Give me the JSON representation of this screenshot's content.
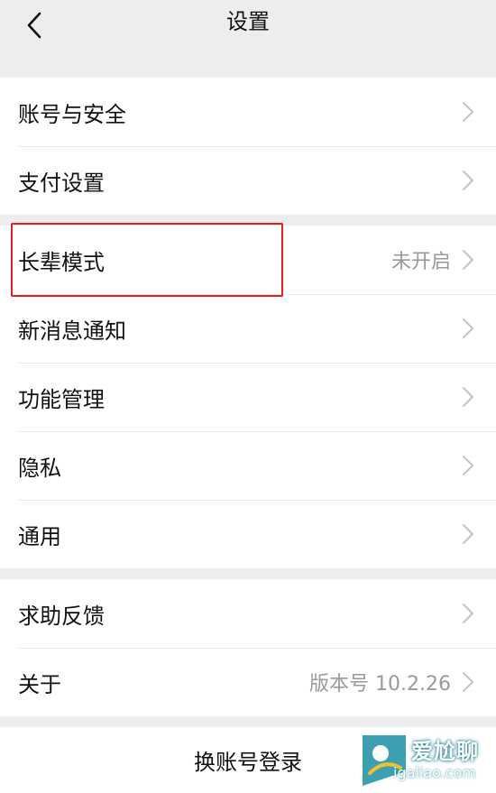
{
  "nav": {
    "title": "设置",
    "back_icon": "chevron-left-icon"
  },
  "groups": [
    {
      "items": [
        {
          "label": "账号与安全",
          "value": ""
        },
        {
          "label": "支付设置",
          "value": ""
        }
      ]
    },
    {
      "items": [
        {
          "label": "长辈模式",
          "value": "未开启"
        },
        {
          "label": "新消息通知",
          "value": ""
        },
        {
          "label": "功能管理",
          "value": ""
        },
        {
          "label": "隐私",
          "value": ""
        },
        {
          "label": "通用",
          "value": ""
        }
      ]
    },
    {
      "items": [
        {
          "label": "求助反馈",
          "value": ""
        },
        {
          "label": "关于",
          "value": "版本号 10.2.26"
        }
      ]
    }
  ],
  "logout": {
    "label": "换账号登录"
  },
  "watermark": {
    "title": "爱尬聊",
    "url": "igaliao.com"
  },
  "colors": {
    "background": "#ededed",
    "card": "#ffffff",
    "highlight_border": "#e02020",
    "secondary_text": "#9a9a9a",
    "chevron": "#c4c4c4"
  }
}
